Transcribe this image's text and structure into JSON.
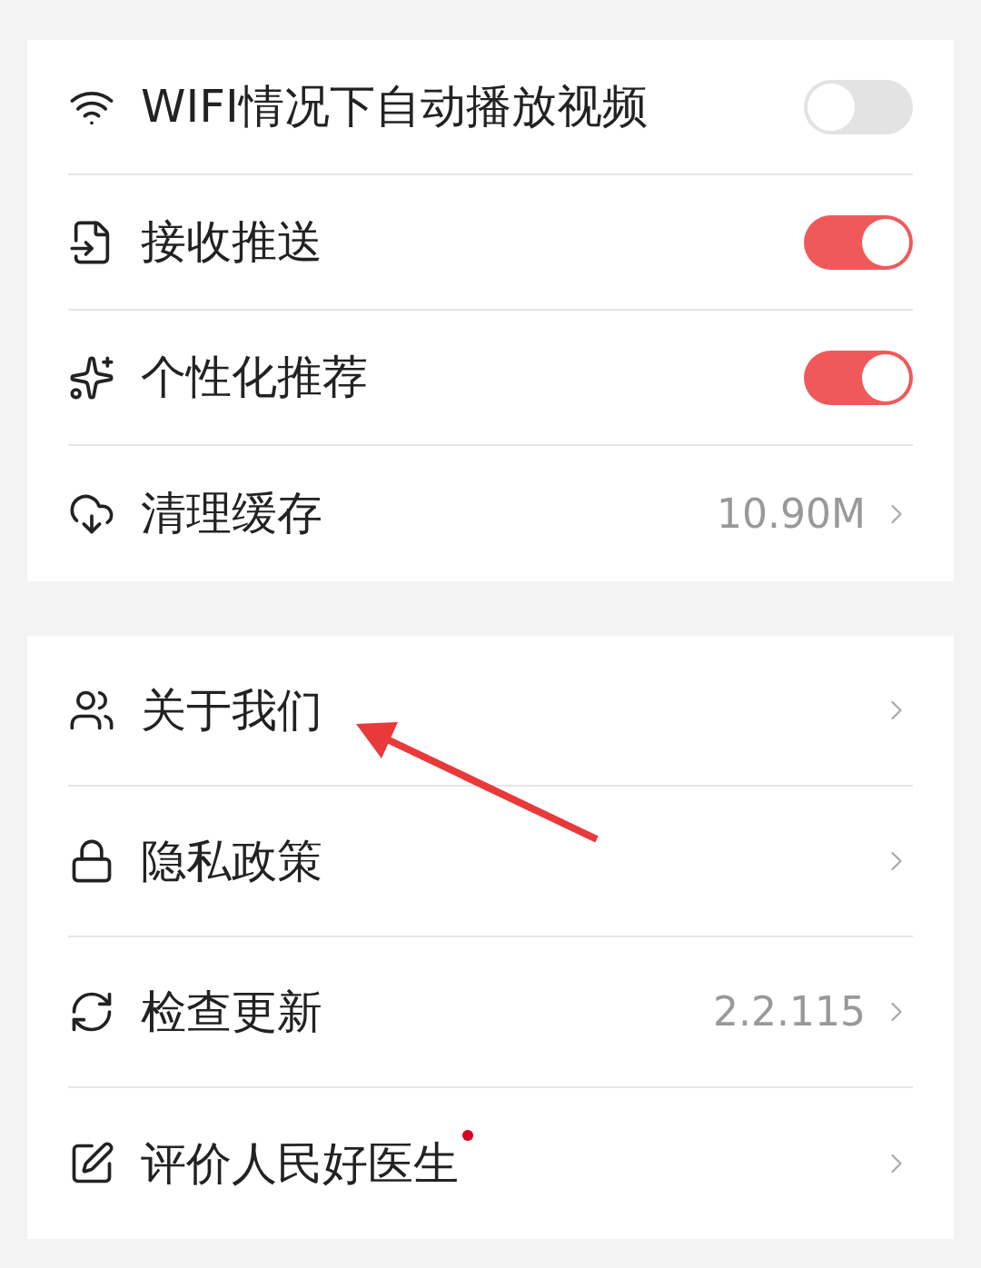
{
  "sections": [
    {
      "items": [
        {
          "kind": "toggle",
          "label": "WIFI情况下自动播放视频",
          "on": false
        },
        {
          "kind": "toggle",
          "label": "接收推送",
          "on": true
        },
        {
          "kind": "toggle",
          "label": "个性化推荐",
          "on": true
        },
        {
          "kind": "value",
          "label": "清理缓存",
          "value": "10.90M"
        }
      ]
    },
    {
      "items": [
        {
          "kind": "link",
          "label": "关于我们",
          "dot": false
        },
        {
          "kind": "link",
          "label": "隐私政策",
          "dot": false
        },
        {
          "kind": "value",
          "label": "检查更新",
          "value": "2.2.115"
        },
        {
          "kind": "link",
          "label": "评价人民好医生",
          "dot": true
        }
      ]
    }
  ]
}
